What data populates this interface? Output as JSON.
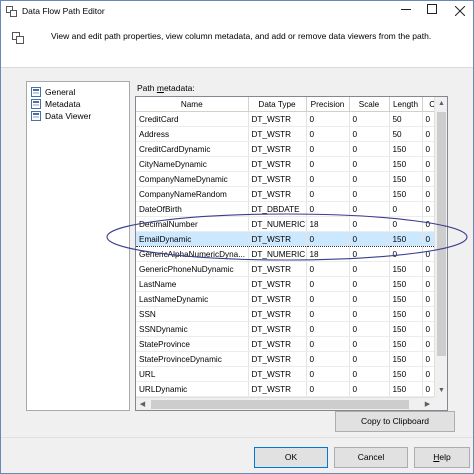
{
  "window": {
    "title": "Data Flow Path Editor",
    "description": "View and edit path properties, view column metadata, and add or remove data viewers from the path."
  },
  "nav": {
    "items": [
      {
        "label": "General"
      },
      {
        "label": "Metadata"
      },
      {
        "label": "Data Viewer"
      }
    ],
    "selected": "Metadata"
  },
  "metadata": {
    "label_pre": "Path ",
    "label_ul": "m",
    "label_post": "etadata:",
    "columns": [
      "Name",
      "Data Type",
      "Precision",
      "Scale",
      "Length",
      "Code"
    ],
    "rows": [
      [
        "CreditCard",
        "DT_WSTR",
        "0",
        "0",
        "50",
        "0"
      ],
      [
        "Address",
        "DT_WSTR",
        "0",
        "0",
        "50",
        "0"
      ],
      [
        "CreditCardDynamic",
        "DT_WSTR",
        "0",
        "0",
        "150",
        "0"
      ],
      [
        "CityNameDynamic",
        "DT_WSTR",
        "0",
        "0",
        "150",
        "0"
      ],
      [
        "CompanyNameDynamic",
        "DT_WSTR",
        "0",
        "0",
        "150",
        "0"
      ],
      [
        "CompanyNameRandom",
        "DT_WSTR",
        "0",
        "0",
        "150",
        "0"
      ],
      [
        "DateOfBirth",
        "DT_DBDATE",
        "0",
        "0",
        "0",
        "0"
      ],
      [
        "DecimalNumber",
        "DT_NUMERIC",
        "18",
        "0",
        "0",
        "0"
      ],
      [
        "EmailDynamic",
        "DT_WSTR",
        "0",
        "0",
        "150",
        "0"
      ],
      [
        "GenericAlphaNumericDyna...",
        "DT_NUMERIC",
        "18",
        "0",
        "0",
        "0"
      ],
      [
        "GenericPhoneNuDynamic",
        "DT_WSTR",
        "0",
        "0",
        "150",
        "0"
      ],
      [
        "LastName",
        "DT_WSTR",
        "0",
        "0",
        "150",
        "0"
      ],
      [
        "LastNameDynamic",
        "DT_WSTR",
        "0",
        "0",
        "150",
        "0"
      ],
      [
        "SSN",
        "DT_WSTR",
        "0",
        "0",
        "150",
        "0"
      ],
      [
        "SSNDynamic",
        "DT_WSTR",
        "0",
        "0",
        "150",
        "0"
      ],
      [
        "StateProvince",
        "DT_WSTR",
        "0",
        "0",
        "150",
        "0"
      ],
      [
        "StateProvinceDynamic",
        "DT_WSTR",
        "0",
        "0",
        "150",
        "0"
      ],
      [
        "URL",
        "DT_WSTR",
        "0",
        "0",
        "150",
        "0"
      ],
      [
        "URLDynamic",
        "DT_WSTR",
        "0",
        "0",
        "150",
        "0"
      ]
    ],
    "selected_row": 8
  },
  "buttons": {
    "copy": "Copy to Clipboard",
    "ok": "OK",
    "cancel": "Cancel",
    "help_ul": "H",
    "help_rest": "elp"
  },
  "colors": {
    "selection": "#cce8ff",
    "annotation_ellipse": "#3c3c8c",
    "window_border": "#6b87b5"
  },
  "icons": {
    "title": "dataflow-path-icon",
    "header": "dataflow-path-icon",
    "nav_item": "property-page-icon"
  }
}
